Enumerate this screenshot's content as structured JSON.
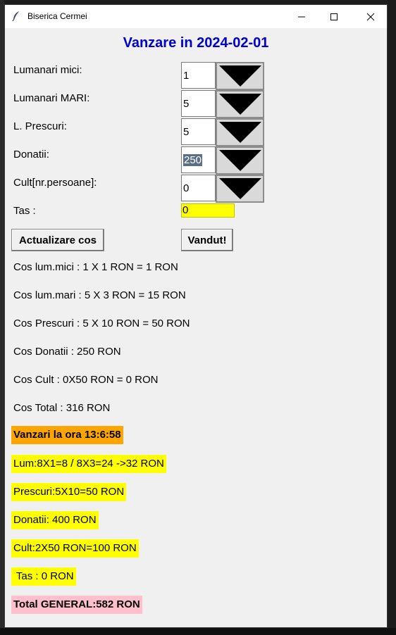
{
  "window": {
    "title": "Biserica Cermei",
    "icon": "feather-icon",
    "controls": [
      "minimize-icon",
      "maximize-icon",
      "close-icon"
    ]
  },
  "header": {
    "title": "Vanzare in 2024-02-01"
  },
  "form": {
    "small_candles": {
      "label": "Lumanari mici:",
      "value": "1"
    },
    "large_candles": {
      "label": "Lumanari MARI:",
      "value": "5"
    },
    "prescuri": {
      "label": "L. Prescuri:",
      "value": "5"
    },
    "donations": {
      "label": "Donatii:",
      "value": "250"
    },
    "cult": {
      "label": "Cult[nr.persoane]:",
      "value": "0"
    },
    "tas": {
      "label": "Tas :",
      "value": "0"
    }
  },
  "buttons": {
    "update": "Actualizare cos",
    "sold": "Vandut!"
  },
  "cart": {
    "small": "Cos lum.mici : 1 X 1 RON = 1 RON",
    "large": "Cos lum.mari : 5 X 3 RON = 15 RON",
    "prescuri": "Cos Prescuri : 5 X 10 RON = 50 RON",
    "donations": "Cos Donatii : 250 RON",
    "cult": "Cos Cult : 0X50 RON = 0 RON",
    "total": "Cos Total : 316 RON"
  },
  "sales": {
    "time": "Vanzari la ora 13:6:58",
    "candles": "Lum:8X1=8 / 8X3=24 ->32 RON",
    "prescuri": "Prescuri:5X10=50 RON",
    "donations": "Donatii: 400 RON",
    "cult": "Cult:2X50 RON=100 RON",
    "tas": " Tas : 0 RON",
    "total": "Total GENERAL:582 RON"
  },
  "colors": {
    "header": "#0000cd",
    "highlight_yellow": "#ffff00",
    "highlight_orange": "#ffa500",
    "highlight_pink": "#ffc0cb",
    "selection": "#5a6f86"
  }
}
